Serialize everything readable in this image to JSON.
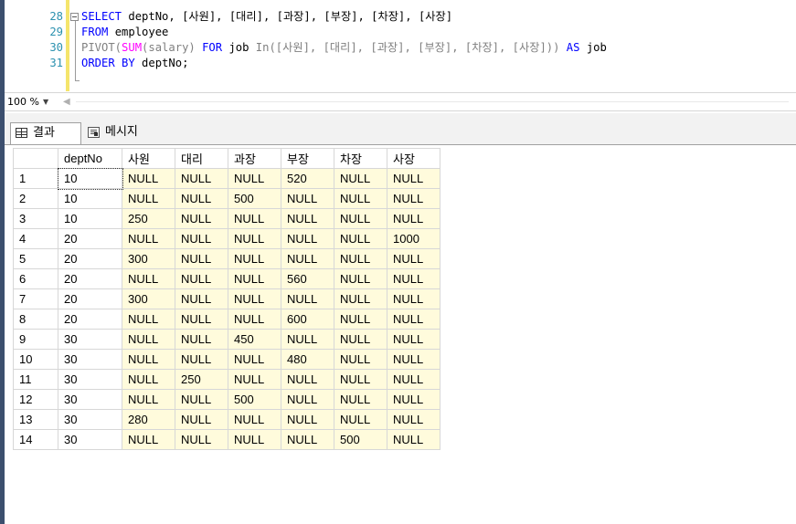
{
  "editor": {
    "lines": [
      {
        "num": "28",
        "tokens": [
          {
            "text": "SELECT",
            "cls": "kw-blue"
          },
          {
            "text": " deptNo, [사원], [대리], [과장], [부장], [차장], [사장]",
            "cls": "txt"
          }
        ]
      },
      {
        "num": "29",
        "tokens": [
          {
            "text": "FROM",
            "cls": "kw-blue"
          },
          {
            "text": " employee",
            "cls": "txt"
          }
        ]
      },
      {
        "num": "30",
        "tokens": [
          {
            "text": "PIVOT(",
            "cls": "kw-gray"
          },
          {
            "text": "SUM",
            "cls": "kw-pink"
          },
          {
            "text": "(salary) ",
            "cls": "kw-gray"
          },
          {
            "text": "FOR",
            "cls": "kw-blue"
          },
          {
            "text": " job ",
            "cls": "txt"
          },
          {
            "text": "In([사원], [대리], [과장], [부장], [차장], [사장])) ",
            "cls": "kw-gray"
          },
          {
            "text": "AS",
            "cls": "kw-blue"
          },
          {
            "text": " job",
            "cls": "txt"
          }
        ]
      },
      {
        "num": "31",
        "tokens": [
          {
            "text": "ORDER BY",
            "cls": "kw-blue"
          },
          {
            "text": " deptNo;",
            "cls": "txt"
          }
        ]
      }
    ]
  },
  "zoom": {
    "value": "100 %"
  },
  "tabs": {
    "results": "결과",
    "messages": "메시지"
  },
  "grid": {
    "columns": [
      "",
      "deptNo",
      "사원",
      "대리",
      "과장",
      "부장",
      "차장",
      "사장"
    ],
    "rows": [
      [
        "1",
        "10",
        "NULL",
        "NULL",
        "NULL",
        "520",
        "NULL",
        "NULL"
      ],
      [
        "2",
        "10",
        "NULL",
        "NULL",
        "500",
        "NULL",
        "NULL",
        "NULL"
      ],
      [
        "3",
        "10",
        "250",
        "NULL",
        "NULL",
        "NULL",
        "NULL",
        "NULL"
      ],
      [
        "4",
        "20",
        "NULL",
        "NULL",
        "NULL",
        "NULL",
        "NULL",
        "1000"
      ],
      [
        "5",
        "20",
        "300",
        "NULL",
        "NULL",
        "NULL",
        "NULL",
        "NULL"
      ],
      [
        "6",
        "20",
        "NULL",
        "NULL",
        "NULL",
        "560",
        "NULL",
        "NULL"
      ],
      [
        "7",
        "20",
        "300",
        "NULL",
        "NULL",
        "NULL",
        "NULL",
        "NULL"
      ],
      [
        "8",
        "20",
        "NULL",
        "NULL",
        "NULL",
        "600",
        "NULL",
        "NULL"
      ],
      [
        "9",
        "30",
        "NULL",
        "NULL",
        "450",
        "NULL",
        "NULL",
        "NULL"
      ],
      [
        "10",
        "30",
        "NULL",
        "NULL",
        "NULL",
        "480",
        "NULL",
        "NULL"
      ],
      [
        "11",
        "30",
        "NULL",
        "250",
        "NULL",
        "NULL",
        "NULL",
        "NULL"
      ],
      [
        "12",
        "30",
        "NULL",
        "NULL",
        "500",
        "NULL",
        "NULL",
        "NULL"
      ],
      [
        "13",
        "30",
        "280",
        "NULL",
        "NULL",
        "NULL",
        "NULL",
        "NULL"
      ],
      [
        "14",
        "30",
        "NULL",
        "NULL",
        "NULL",
        "NULL",
        "500",
        "NULL"
      ]
    ]
  },
  "colors": {
    "cell_bg": "#fffbdc",
    "keyword_blue": "#0000ff",
    "function_pink": "#ff00ff",
    "line_number": "#2b91af"
  }
}
